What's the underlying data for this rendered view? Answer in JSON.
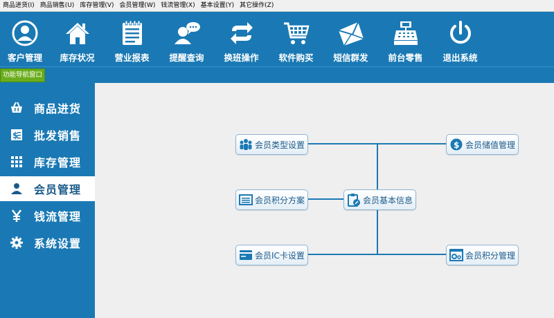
{
  "menu": [
    "商品进货(I)",
    "商品销售(U)",
    "库存管理(V)",
    "会员管理(W)",
    "钱流管理(X)",
    "基本设置(Y)",
    "其它操作(Z)"
  ],
  "toolbar": [
    {
      "label": "客户管理",
      "icon": "user-circle-icon"
    },
    {
      "label": "库存状况",
      "icon": "house-icon"
    },
    {
      "label": "营业报表",
      "icon": "report-icon"
    },
    {
      "label": "提醒查询",
      "icon": "chat-user-icon"
    },
    {
      "label": "换班操作",
      "icon": "swap-icon"
    },
    {
      "label": "软件购买",
      "icon": "cart-icon"
    },
    {
      "label": "短信群发",
      "icon": "envelope-icon"
    },
    {
      "label": "前台零售",
      "icon": "cash-register-icon"
    },
    {
      "label": "退出系统",
      "icon": "power-icon"
    }
  ],
  "nav_title": "功能导航窗口",
  "sidebar": [
    {
      "label": "商品进货",
      "icon": "basket-icon"
    },
    {
      "label": "批发销售",
      "icon": "invoice-icon"
    },
    {
      "label": "库存管理",
      "icon": "grid-icon"
    },
    {
      "label": "会员管理",
      "icon": "member-icon",
      "active": true
    },
    {
      "label": "钱流管理",
      "icon": "yen-icon"
    },
    {
      "label": "系统设置",
      "icon": "gear-icon"
    }
  ],
  "nodes": {
    "type_settings": "会员类型设置",
    "stored_value": "会员储值管理",
    "points_plan": "会员积分方案",
    "basic_info": "会员基本信息",
    "ic_card": "会员IC卡设置",
    "points_mgmt": "会员积分管理"
  },
  "colors": {
    "primary": "#1a79b4",
    "nav_title": "#6aad1c",
    "active_item": "#ffffff",
    "background": "#efefef"
  }
}
